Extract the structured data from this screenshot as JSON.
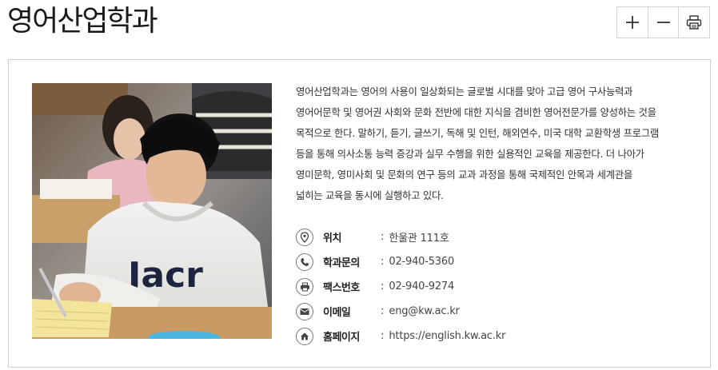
{
  "header": {
    "title": "영어산업학과"
  },
  "toolbar": {
    "buttons": [
      {
        "icon": "plus-icon",
        "action": "zoom-in"
      },
      {
        "icon": "minus-icon",
        "action": "zoom-out"
      },
      {
        "icon": "printer-icon",
        "action": "print"
      }
    ]
  },
  "department": {
    "photo_description_icon": "student-photo",
    "description_lines": [
      "영어산업학과는 영어의 사용이 일상화되는 글로벌 시대를 맞아 고급 영어 구사능력과",
      "영어어문학 및 영어권 사회와 문화 전반에 대한 지식을 겸비한 영어전문가를 양성하는 것을",
      "목적으로 한다. 말하기, 듣기, 글쓰기, 독해 및 인턴, 해외연수, 미국 대학 교환학생 프로그램",
      "등을 통해 의사소통 능력 증강과 실무 수행을 위한 실용적인 교육을 제공한다. 더 나아가",
      "영미문학, 영미사회 및 문화의 연구 등의 교과 과정을 통해 국제적인 안목과 세계관을",
      "넓히는 교육을 동시에 실행하고 있다."
    ],
    "info": [
      {
        "icon": "location-pin-icon",
        "label": "위치",
        "value": "한울관 111호"
      },
      {
        "icon": "phone-icon",
        "label": "학과문의",
        "value": "02-940-5360"
      },
      {
        "icon": "fax-icon",
        "label": "팩스번호",
        "value": "02-940-9274"
      },
      {
        "icon": "email-icon",
        "label": "이메일",
        "value": "eng@kw.ac.kr"
      },
      {
        "icon": "home-icon",
        "label": "홈페이지",
        "value": "https://english.kw.ac.kr"
      }
    ],
    "separator": ":",
    "photo_shirt_text": "Jacr"
  }
}
